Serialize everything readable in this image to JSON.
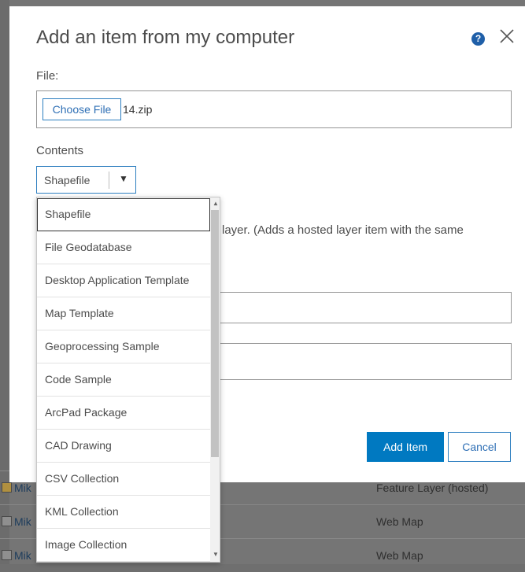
{
  "dialog": {
    "title": "Add an item from my computer",
    "help_icon": "?",
    "file_label": "File:",
    "choose_file_label": "Choose File",
    "file_name": "14.zip",
    "contents_label": "Contents",
    "contents_selected": "Shapefile",
    "description_fragment": "layer. (Adds a hosted layer item with the same",
    "add_item_label": "Add Item",
    "cancel_label": "Cancel"
  },
  "dropdown": {
    "options": [
      "Shapefile",
      "File Geodatabase",
      "Desktop Application Template",
      "Map Template",
      "Geoprocessing Sample",
      "Code Sample",
      "ArcPad Package",
      "CAD Drawing",
      "CSV Collection",
      "KML Collection",
      "Image Collection"
    ]
  },
  "background": {
    "rows": [
      {
        "name": "Mik",
        "type": "Feature Layer (hosted)"
      },
      {
        "name": "Mik",
        "type": "Web Map"
      },
      {
        "name": "Mik",
        "type": "Web Map"
      }
    ]
  },
  "colors": {
    "accent": "#0079c1",
    "help": "#1f5fa8",
    "overlay": "#757575"
  }
}
